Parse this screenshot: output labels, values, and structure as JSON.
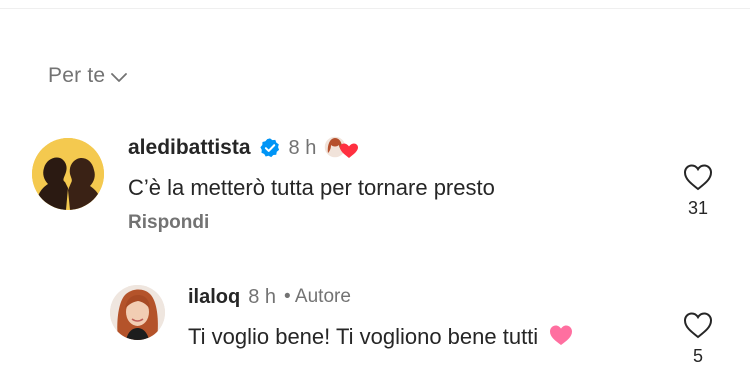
{
  "sort": {
    "label": "Per te"
  },
  "comments": [
    {
      "username": "aledibattista",
      "time": "8 h",
      "verified": true,
      "text": "C’è la metterò tutta per tornare presto",
      "reply_label": "Rispondi",
      "likes": "31",
      "reaction": "author-heart-reaction"
    },
    {
      "username": "ilaloq",
      "time": "8 h",
      "author_badge": "• Autore",
      "text": "Ti voglio bene! Ti vogliono bene tutti",
      "likes": "5",
      "emoji": "pink-heart"
    }
  ],
  "colors": {
    "text": "#262626",
    "secondary": "#737373",
    "verified_blue": "#0095f6",
    "heart_red": "#ff3040",
    "heart_pink": "#ff6fa0"
  }
}
